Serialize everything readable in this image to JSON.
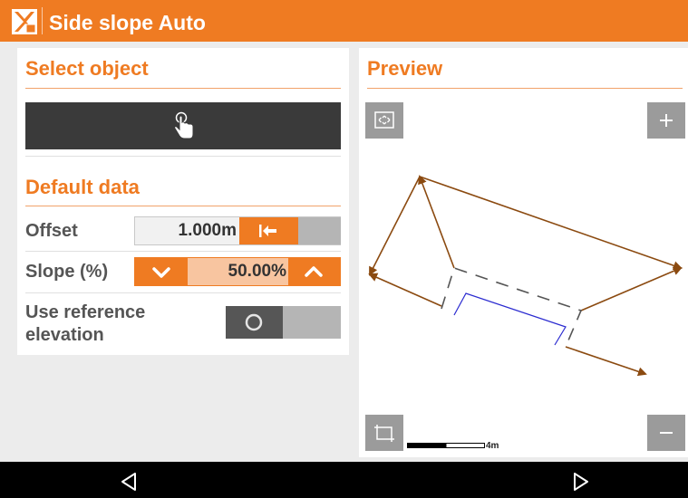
{
  "app": {
    "title": "Side slope Auto",
    "logo_icon": "app-logo-icon",
    "accent_color": "#ef7b22"
  },
  "select_object": {
    "title": "Select object",
    "button_icon": "tap-hand-icon"
  },
  "default_data": {
    "title": "Default data",
    "offset": {
      "label": "Offset",
      "value": "1.000m",
      "toggle_icon": "arrow-to-left-icon",
      "toggle_on": true
    },
    "slope": {
      "label": "Slope (%)",
      "value": "50.00%",
      "decrease_icon": "chevron-down-icon",
      "increase_icon": "chevron-up-icon"
    },
    "reference_elevation": {
      "label": "Use reference elevation",
      "toggle_on": false
    }
  },
  "preview": {
    "title": "Preview",
    "zoom_extents_icon": "zoom-extents-icon",
    "zoom_in_icon": "plus-icon",
    "zoom_out_icon": "minus-icon",
    "crop_icon": "crop-icon",
    "scale_label": "4m"
  },
  "navigation": {
    "back_icon": "nav-back-icon",
    "forward_icon": "nav-forward-icon"
  }
}
